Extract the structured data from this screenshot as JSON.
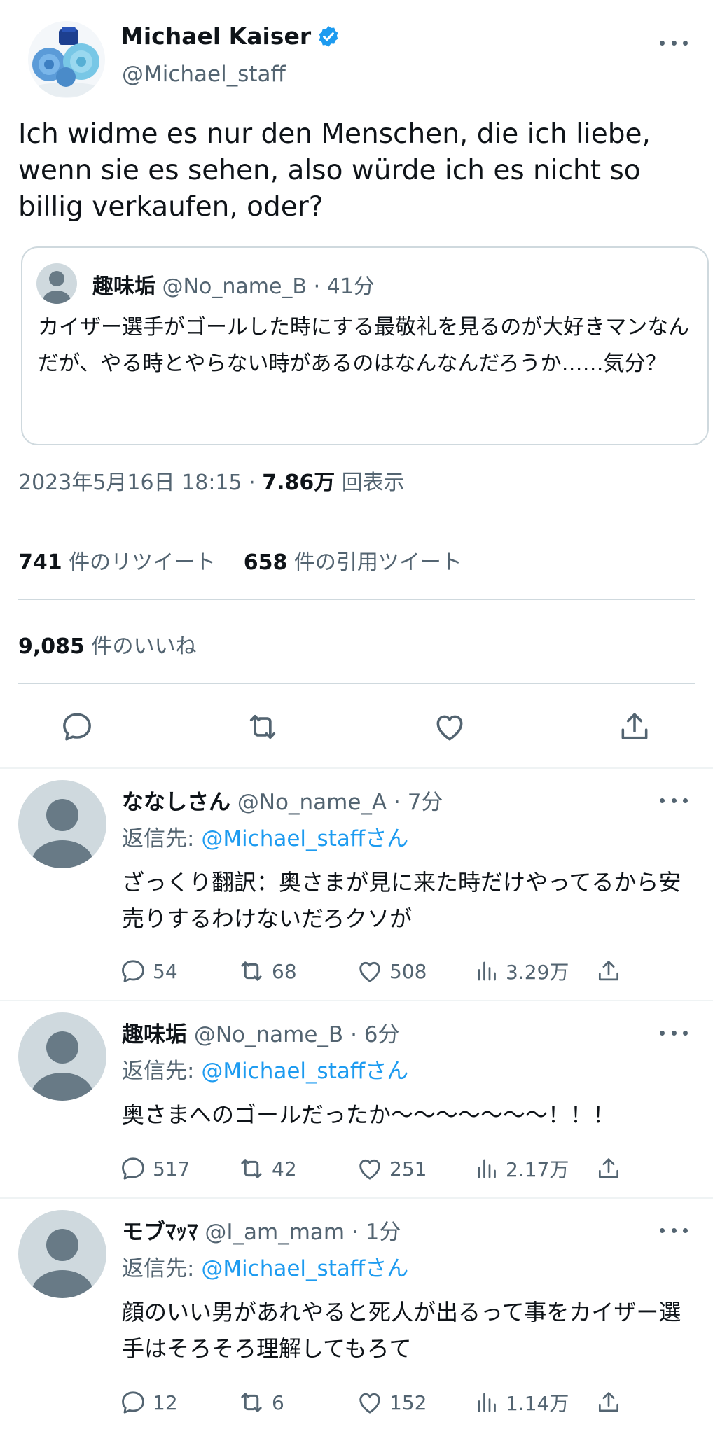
{
  "main_tweet": {
    "author_name": "Michael Kaiser",
    "author_handle": "@Michael_staff",
    "text": "Ich widme es nur den Menschen, die ich liebe, wenn sie es sehen, also würde ich es nicht so billig verkaufen, oder?",
    "timestamp": "2023年5月16日 18:15 ·",
    "views_count": "7.86万",
    "views_label": "回表示",
    "retweets_count": "741",
    "retweets_label": "件のリツイート",
    "quotes_count": "658",
    "quotes_label": "件の引用ツイート",
    "likes_count": "9,085",
    "likes_label": "件のいいね"
  },
  "quoted_tweet": {
    "author_name": "趣味垢",
    "author_handle": "@No_name_B",
    "time": "· 41分",
    "text": "カイザー選手がゴールした時にする最敬礼を見るのが大好きマンなんだが、やる時とやらない時があるのはなんなんだろうか……気分？"
  },
  "replies": [
    {
      "author_name": "ななしさん",
      "author_handle": "@No_name_A",
      "time": "· 7分",
      "reply_to_label": "返信先:",
      "reply_to_handle": "@Michael_staffさん",
      "text": "ざっくり翻訳：奥さまが見に来た時だけやってるから安売りするわけないだろクソが",
      "replies": "54",
      "retweets": "68",
      "likes": "508",
      "views": "3.29万"
    },
    {
      "author_name": "趣味垢",
      "author_handle": "@No_name_B",
      "time": "· 6分",
      "reply_to_label": "返信先:",
      "reply_to_handle": "@Michael_staffさん",
      "text": "奥さまへのゴールだったか〜〜〜〜〜〜〜！！！",
      "replies": "517",
      "retweets": "42",
      "likes": "251",
      "views": "2.17万"
    },
    {
      "author_name": "モブﾏｯﾏ",
      "author_handle": "@I_am_mam",
      "time": "· 1分",
      "reply_to_label": "返信先:",
      "reply_to_handle": "@Michael_staffさん",
      "text": "顔のいい男があれやると死人が出るって事をカイザー選手はそろそろ理解してもろて",
      "replies": "12",
      "retweets": "6",
      "likes": "152",
      "views": "1.14万"
    }
  ],
  "icons": {
    "reply": "comment-icon",
    "retweet": "retweet-icon",
    "like": "heart-icon",
    "share": "share-icon",
    "views": "views-icon",
    "more": "more-icon",
    "verified": "verified-badge-icon"
  },
  "colors": {
    "link": "#1d9bf0",
    "muted": "#536471",
    "verified": "#1d9bf0"
  }
}
